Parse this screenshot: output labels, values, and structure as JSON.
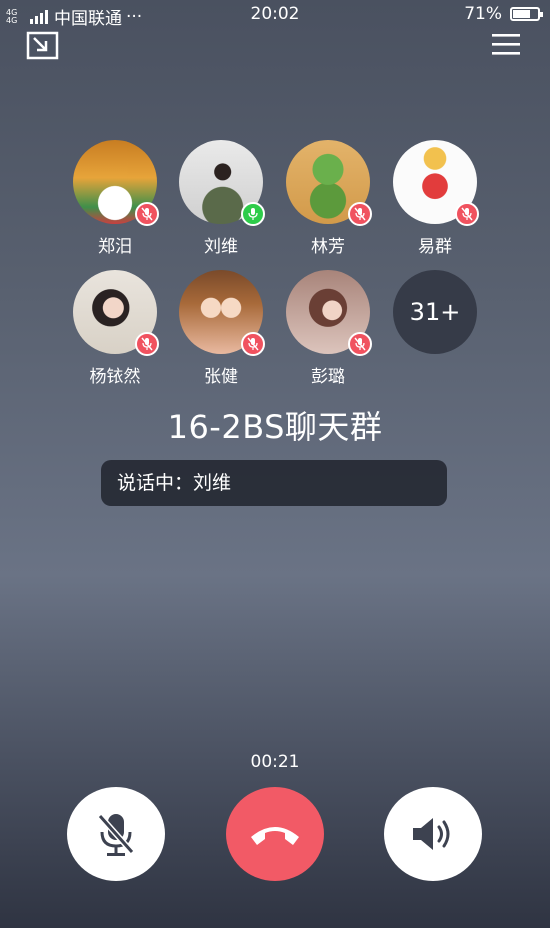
{
  "status_bar": {
    "network": "4G 4G",
    "carrier": "中国联通",
    "dots": "···",
    "time": "20:02",
    "battery": "71%",
    "battery_level": 0.71
  },
  "members": [
    {
      "name": "郑汨",
      "mic": "muted"
    },
    {
      "name": "刘维",
      "mic": "active"
    },
    {
      "name": "林芳",
      "mic": "muted"
    },
    {
      "name": "易群",
      "mic": "muted"
    },
    {
      "name": "杨铱然",
      "mic": "muted"
    },
    {
      "name": "张健",
      "mic": "muted"
    },
    {
      "name": "彭璐",
      "mic": "muted"
    }
  ],
  "more_members": "31+",
  "group_name": "16-2BS聊天群",
  "speaking_label": "说话中：刘维",
  "call_timer": "00:21",
  "colors": {
    "muted_badge": "#f0525f",
    "active_badge": "#2ecc4a",
    "hangup": "#f25a66"
  }
}
